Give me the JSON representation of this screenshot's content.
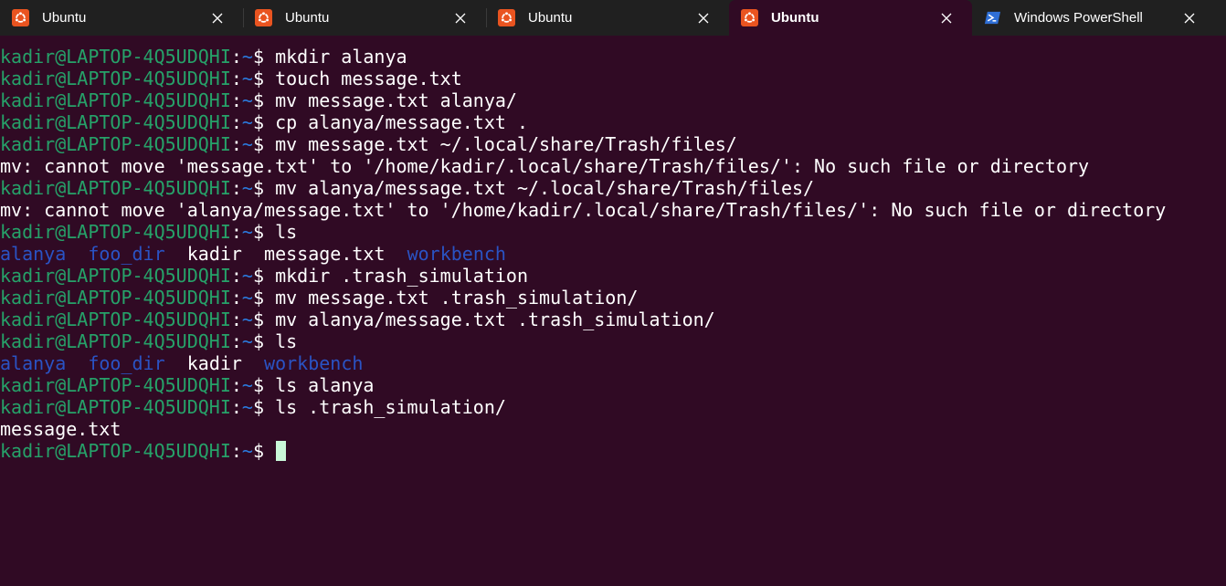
{
  "tabs": [
    {
      "title": "Ubuntu",
      "icon": "ubuntu-icon",
      "active": false
    },
    {
      "title": "Ubuntu",
      "icon": "ubuntu-icon",
      "active": false
    },
    {
      "title": "Ubuntu",
      "icon": "ubuntu-icon",
      "active": false
    },
    {
      "title": "Ubuntu",
      "icon": "ubuntu-icon",
      "active": true
    },
    {
      "title": "Windows PowerShell",
      "icon": "powershell-icon",
      "active": false
    }
  ],
  "colors": {
    "background": "#300a24",
    "tabbar": "#202020",
    "prompt_user": "#26a269",
    "prompt_path": "#2a7bde",
    "directory": "#2a53c4",
    "ubuntu_orange": "#e95420",
    "cursor": "#c9f7d8"
  },
  "prompt": {
    "user_host": "kadir@LAPTOP-4Q5UDQHI",
    "colon": ":",
    "path": "~",
    "symbol": "$ "
  },
  "terminal_lines": [
    {
      "type": "prompt",
      "command": "mkdir alanya"
    },
    {
      "type": "prompt",
      "command": "touch message.txt"
    },
    {
      "type": "prompt",
      "command": "mv message.txt alanya/"
    },
    {
      "type": "prompt",
      "command": "cp alanya/message.txt ."
    },
    {
      "type": "prompt",
      "command": "mv message.txt ~/.local/share/Trash/files/"
    },
    {
      "type": "output",
      "text": "mv: cannot move 'message.txt' to '/home/kadir/.local/share/Trash/files/': No such file or directory"
    },
    {
      "type": "prompt",
      "command": "mv alanya/message.txt ~/.local/share/Trash/files/"
    },
    {
      "type": "output",
      "text": "mv: cannot move 'alanya/message.txt' to '/home/kadir/.local/share/Trash/files/': No such file or directory"
    },
    {
      "type": "prompt",
      "command": "ls"
    },
    {
      "type": "listing",
      "entries": [
        {
          "name": "alanya",
          "kind": "dir"
        },
        {
          "name": "foo_dir",
          "kind": "dir"
        },
        {
          "name": "kadir",
          "kind": "file"
        },
        {
          "name": "message.txt",
          "kind": "file"
        },
        {
          "name": "workbench",
          "kind": "dir"
        }
      ]
    },
    {
      "type": "prompt",
      "command": "mkdir .trash_simulation"
    },
    {
      "type": "prompt",
      "command": "mv message.txt .trash_simulation/"
    },
    {
      "type": "prompt",
      "command": "mv alanya/message.txt .trash_simulation/"
    },
    {
      "type": "prompt",
      "command": "ls"
    },
    {
      "type": "listing",
      "entries": [
        {
          "name": "alanya",
          "kind": "dir"
        },
        {
          "name": "foo_dir",
          "kind": "dir"
        },
        {
          "name": "kadir",
          "kind": "file"
        },
        {
          "name": "workbench",
          "kind": "dir"
        }
      ]
    },
    {
      "type": "prompt",
      "command": "ls alanya"
    },
    {
      "type": "prompt",
      "command": "ls .trash_simulation/"
    },
    {
      "type": "output",
      "text": "message.txt"
    },
    {
      "type": "prompt",
      "command": "",
      "cursor": true
    }
  ]
}
